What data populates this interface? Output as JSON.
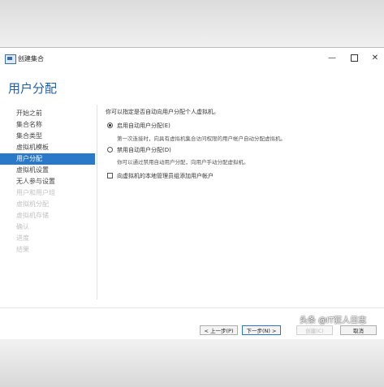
{
  "window": {
    "title": "创建集合",
    "page_title": "用户分配",
    "minimize_glyph": "—",
    "close_glyph": "✕"
  },
  "nav": {
    "items": [
      {
        "label": "开始之前",
        "state": "normal"
      },
      {
        "label": "集合名称",
        "state": "normal"
      },
      {
        "label": "集合类型",
        "state": "normal"
      },
      {
        "label": "虚拟机模板",
        "state": "normal"
      },
      {
        "label": "用户分配",
        "state": "active"
      },
      {
        "label": "虚拟机设置",
        "state": "normal"
      },
      {
        "label": "无人参与设置",
        "state": "normal"
      },
      {
        "label": "用户和用户组",
        "state": "disabled"
      },
      {
        "label": "虚拟机分配",
        "state": "disabled"
      },
      {
        "label": "虚拟机存储",
        "state": "disabled"
      },
      {
        "label": "确认",
        "state": "disabled"
      },
      {
        "label": "进度",
        "state": "disabled"
      },
      {
        "label": "结果",
        "state": "disabled"
      }
    ]
  },
  "content": {
    "intro": "你可以指定是否自动向用户分配个人虚拟机。",
    "option_auto": {
      "label": "启用自动用户分配(E)",
      "description": "第一次连接时，向具有虚拟机集合访问权限的用户帐户自动分配虚拟机。",
      "checked": true
    },
    "option_manual": {
      "label": "禁用自动用户分配(D)",
      "description": "你可以通过禁用自动用户分配，向用户手动分配虚拟机。",
      "checked": false
    },
    "checkbox_admin": {
      "label": "向虚拟机的本地管理员组添加用户帐户",
      "checked": false
    }
  },
  "footer": {
    "prev": "< 上一步(P)",
    "next": "下一步(N) >",
    "create": "创建(C)",
    "cancel": "取消"
  },
  "watermark": "头条 @IT狂人日志"
}
